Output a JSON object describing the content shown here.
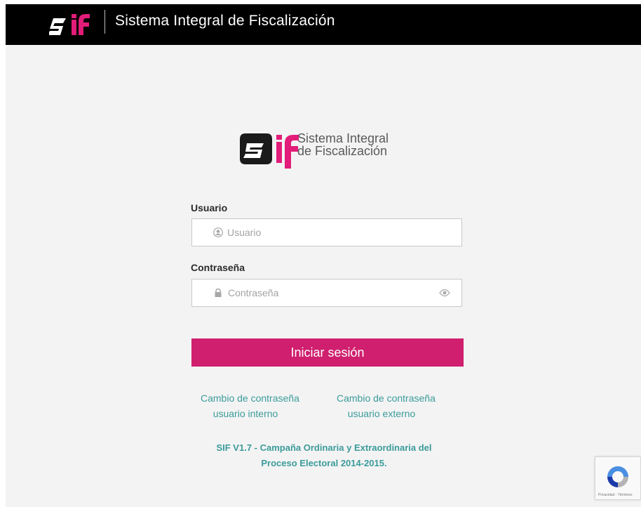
{
  "header": {
    "logo_name": "sif-logo",
    "title": "Sistema Integral de Fiscalización"
  },
  "brand": {
    "line1": "Sistema Integral",
    "line2": "de Fiscalización"
  },
  "form": {
    "user_label": "Usuario",
    "user_placeholder": "Usuario",
    "password_label": "Contraseña",
    "password_placeholder": "Contraseña",
    "submit_label": "Iniciar sesión"
  },
  "links": {
    "internal_line1": "Cambio de contraseña",
    "internal_line2": "usuario interno",
    "external_line1": "Cambio de contraseña",
    "external_line2": "usuario externo"
  },
  "footer": {
    "version_line1": "SIF V1.7 - Campaña Ordinaria y Extraordinaria del",
    "version_line2": "Proceso Electoral 2014-2015."
  },
  "recaptcha": {
    "footer_text": "Privacidad - Términos"
  },
  "colors": {
    "accent": "#cf1f6e",
    "link": "#3c9b9b",
    "topbar": "#000000",
    "background": "#f3f3f3"
  }
}
